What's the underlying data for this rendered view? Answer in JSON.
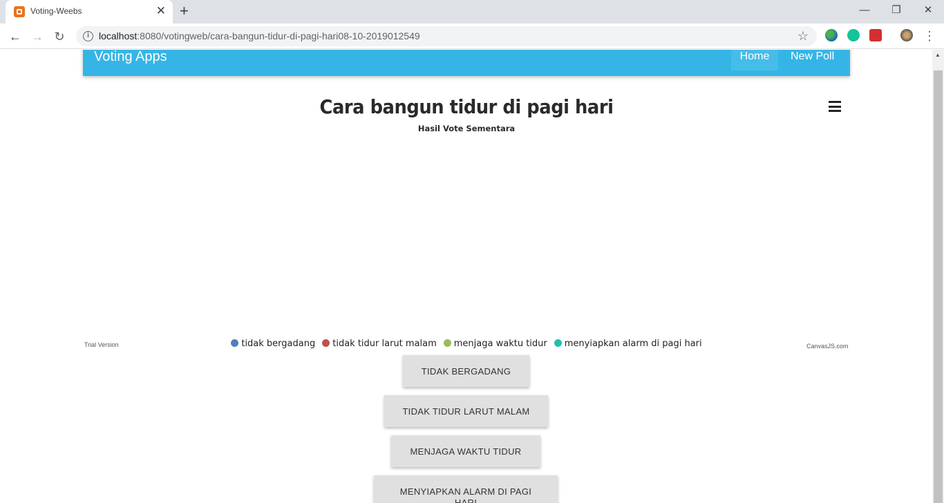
{
  "browser": {
    "tab_title": "Voting-Weebs",
    "url_host": "localhost",
    "url_path": ":8080/votingweb/cara-bangun-tidur-di-pagi-hari08-10-2019012549"
  },
  "navbar": {
    "brand": "Voting Apps",
    "links": [
      "Home",
      "New Poll"
    ]
  },
  "chart": {
    "title": "Cara bangun tidur di pagi hari",
    "subtitle": "Hasil Vote Sementara",
    "trial_label": "Trial Version",
    "credit": "CanvasJS.com"
  },
  "chart_data": {
    "type": "pie",
    "title": "Cara bangun tidur di pagi hari",
    "subtitle": "Hasil Vote Sementara",
    "legend_position": "bottom",
    "series": [
      {
        "name": "tidak bergadang",
        "value": 0,
        "color": "#4f81bc"
      },
      {
        "name": "tidak tidur larut malam",
        "value": 0,
        "color": "#c0504e"
      },
      {
        "name": "menjaga waktu tidur",
        "value": 0,
        "color": "#9bbb58"
      },
      {
        "name": "menyiapkan alarm di pagi hari",
        "value": 0,
        "color": "#23bfaa"
      }
    ]
  },
  "vote_buttons": [
    "TIDAK BERGADANG",
    "TIDAK TIDUR LARUT MALAM",
    "MENJAGA WAKTU TIDUR",
    "MENYIAPKAN ALARM DI PAGI HARI"
  ],
  "colors": {
    "navbar": "#35b5e5",
    "button_bg": "#e0e0e0"
  }
}
